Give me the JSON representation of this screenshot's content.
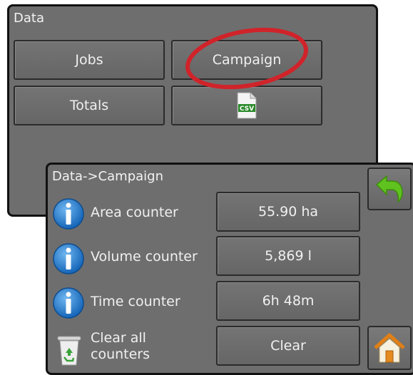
{
  "data_panel": {
    "title": "Data",
    "buttons": {
      "jobs": "Jobs",
      "campaign": "Campaign",
      "totals": "Totals",
      "csv_badge": "CSV"
    }
  },
  "campaign_panel": {
    "title": "Data->Campaign",
    "rows": [
      {
        "label": "Area counter",
        "value": "55.90 ha",
        "icon": "info-icon"
      },
      {
        "label": "Volume counter",
        "value": "5,869 l",
        "icon": "info-icon"
      },
      {
        "label": "Time counter",
        "value": "6h 48m",
        "icon": "info-icon"
      }
    ],
    "clear": {
      "label_line1": "Clear all",
      "label_line2": "counters",
      "button": "Clear",
      "icon": "recycle-bin-icon"
    },
    "side_buttons": {
      "back": "back-arrow-icon",
      "home": "home-icon"
    }
  },
  "colors": {
    "panel_bg": "#6e6e6e",
    "highlight_ellipse": "#d0232a",
    "info_blue": "#1e7fd0",
    "back_arrow_green": "#5fc21e",
    "csv_green": "#2a8a2a"
  }
}
